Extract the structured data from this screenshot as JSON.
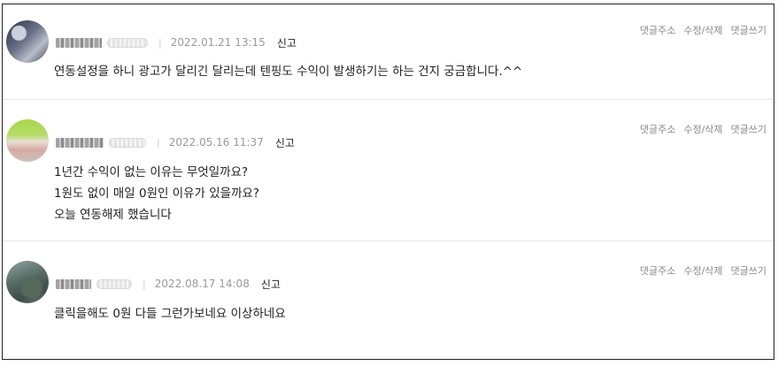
{
  "comments": [
    {
      "date": "2022.01.21 13:15",
      "report_label": "신고",
      "actions": [
        "댓글주소",
        "수정/삭제",
        "댓글쓰기"
      ],
      "lines": [
        "연동설정을 하니 광고가 달리긴 달리는데 텐핑도 수익이 발생하기는 하는 건지 궁금합니다.^^"
      ]
    },
    {
      "date": "2022.05.16 11:37",
      "report_label": "신고",
      "actions": [
        "댓글주소",
        "수정/삭제",
        "댓글쓰기"
      ],
      "lines": [
        "1년간 수익이 없는 이유는 무엇일까요?",
        "1원도 없이 매일 0원인 이유가 있을까요?",
        "오늘 연동해제 했습니다"
      ]
    },
    {
      "date": "2022.08.17 14:08",
      "report_label": "신고",
      "actions": [
        "댓글주소",
        "수정/삭제",
        "댓글쓰기"
      ],
      "lines": [
        "클릭을해도 0원 다들 그런가보네요 이상하네요"
      ]
    }
  ]
}
